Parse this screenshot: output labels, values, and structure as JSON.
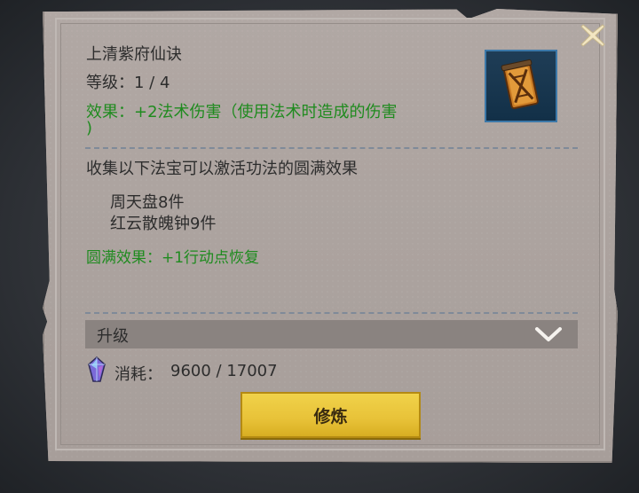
{
  "skill": {
    "title": "上清紫府仙诀",
    "level_label": "等级",
    "level_value": "1 / 4",
    "effect_label": "效果",
    "effect_text_line1": "+2法术伤害（使用法术时造成的伤害",
    "effect_text_line2": ")"
  },
  "collection": {
    "description": "收集以下法宝可以激活功法的圆满效果",
    "items": [
      "周天盘8件",
      "红云散魄钟9件"
    ],
    "full_effect_label": "圆满效果",
    "full_effect_text": "+1行动点恢复"
  },
  "upgrade": {
    "label": "升级",
    "cost_label": "消耗",
    "cost_value": "9600 / 17007"
  },
  "actions": {
    "cultivate_label": "修炼"
  },
  "icons": {
    "skill_icon": "jade-tablet-icon",
    "close_icon": "close-x-icon",
    "expand_icon": "chevron-down-icon",
    "cost_icon": "spirit-crystal-icon"
  },
  "colors": {
    "effect_green": "#1f8b1f",
    "button_gold": "#e8c238"
  }
}
